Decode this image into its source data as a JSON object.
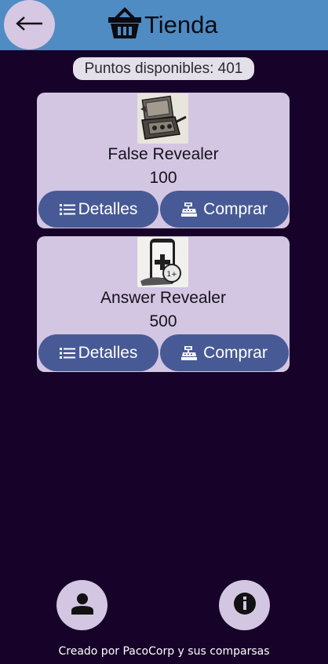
{
  "header": {
    "title": "Tienda",
    "back_icon": "arrow-left-icon",
    "shop_icon": "shop-basket-icon",
    "color": "#4f8cc3"
  },
  "points": {
    "label": "Puntos disponibles: 401"
  },
  "items": [
    {
      "name": "False Revealer",
      "price": "100",
      "image_icon": "lockbox-machine-image",
      "details_label": "Detalles",
      "buy_label": "Comprar"
    },
    {
      "name": "Answer Revealer",
      "price": "500",
      "image_icon": "phone-plus-image",
      "details_label": "Detalles",
      "buy_label": "Comprar"
    }
  ],
  "bottom": {
    "profile_icon": "person-icon",
    "info_icon": "info-icon"
  },
  "footer": {
    "text": "Creado por PacoCorp y sus comparsas"
  },
  "colors": {
    "background": "#170229",
    "card": "#d3c6e2",
    "button": "#475a96"
  }
}
